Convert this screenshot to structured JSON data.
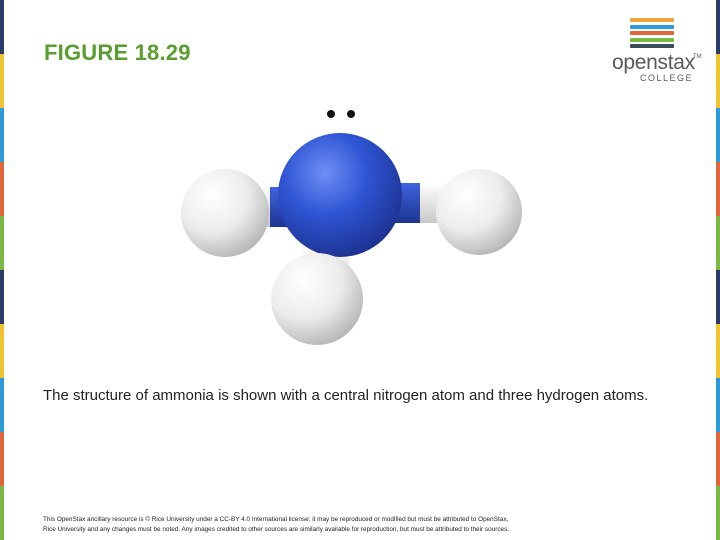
{
  "slide": {
    "title": "FIGURE 18.29",
    "caption": "The structure of ammonia is shown with a central nitrogen atom and three hydrogen atoms.",
    "footer_line1": "This OpenStax ancillary resource is © Rice University under a CC-BY 4.0 International license; it may be reproduced or modified but must be attributed to OpenStax,",
    "footer_line2": "Rice University and any changes must be noted. Any images credited to other sources are similarly available for reproduction, but must be attributed to their sources."
  },
  "logo": {
    "word": "openstax",
    "trademark": "TM",
    "sub": "COLLEGE",
    "bar_colors": [
      "#f0a43b",
      "#2e9bd6",
      "#e0653a",
      "#78b843",
      "#3b4a5a"
    ]
  },
  "edge_colors": [
    "#2e3a68",
    "#f0c330",
    "#2e9bd6",
    "#e0653a",
    "#78b843",
    "#2e3a68",
    "#f0c330",
    "#2e9bd6",
    "#e0653a",
    "#78b843"
  ],
  "molecule": {
    "central_atom_color": "#2f55d4",
    "hydrogen_color": "#f2f2f2",
    "lone_pair_color": "#111111"
  }
}
